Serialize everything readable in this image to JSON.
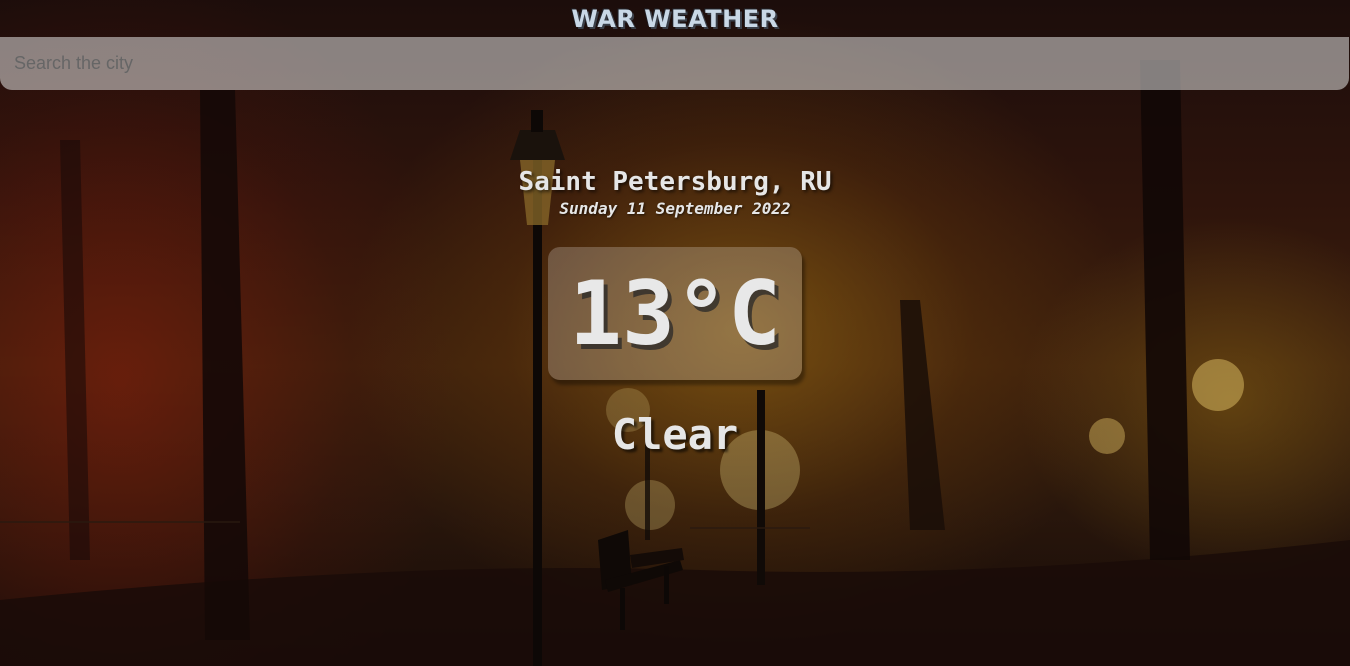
{
  "app": {
    "title": "WAR WEATHER"
  },
  "search": {
    "placeholder": "Search the city",
    "value": ""
  },
  "weather": {
    "location": "Saint Petersburg, RU",
    "date": "Sunday 11 September 2022",
    "temperature": "13°C",
    "condition": "Clear"
  },
  "background": {
    "scene": "autumn park at night with street lamps and bench",
    "colors": {
      "dark": "#1c0d0b",
      "amber": "#aa7814",
      "red": "#8c1e0a"
    }
  }
}
